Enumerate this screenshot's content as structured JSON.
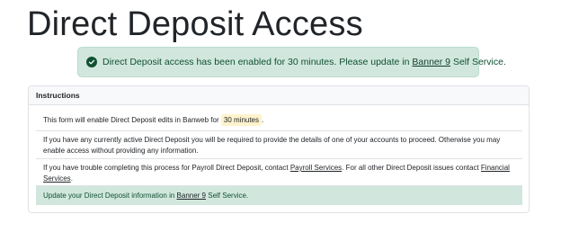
{
  "page": {
    "title": "Direct Deposit Access"
  },
  "alert": {
    "text_before": "Direct Deposit access has been enabled for 30 minutes. Please update in",
    "link_label": "Banner 9",
    "text_after": "Self Service.",
    "icon": "check-circle-icon",
    "color": "#0f5132",
    "background": "#d1e7dd"
  },
  "instructions": {
    "header": "Instructions",
    "item1": {
      "text_before": "This form will enable Direct Deposit edits in Banweb for",
      "highlight": "30 minutes",
      "text_after": "."
    },
    "item2": {
      "text": "If you have any currently active Direct Deposit you will be required to provide the details of one of your accounts to proceed. Otherwise you may enable access without providing any information."
    },
    "item3": {
      "text_before": "If you have trouble completing this process for Payroll Direct Deposit, contact",
      "link1_label": "Payroll Services",
      "text_middle": ". For all other Direct Deposit issues contact",
      "link2_label": "Financial Services",
      "text_after": "."
    },
    "item4": {
      "text_before": "Update your Direct Deposit information in",
      "link_label": "Banner 9",
      "text_after": "Self Service."
    }
  }
}
